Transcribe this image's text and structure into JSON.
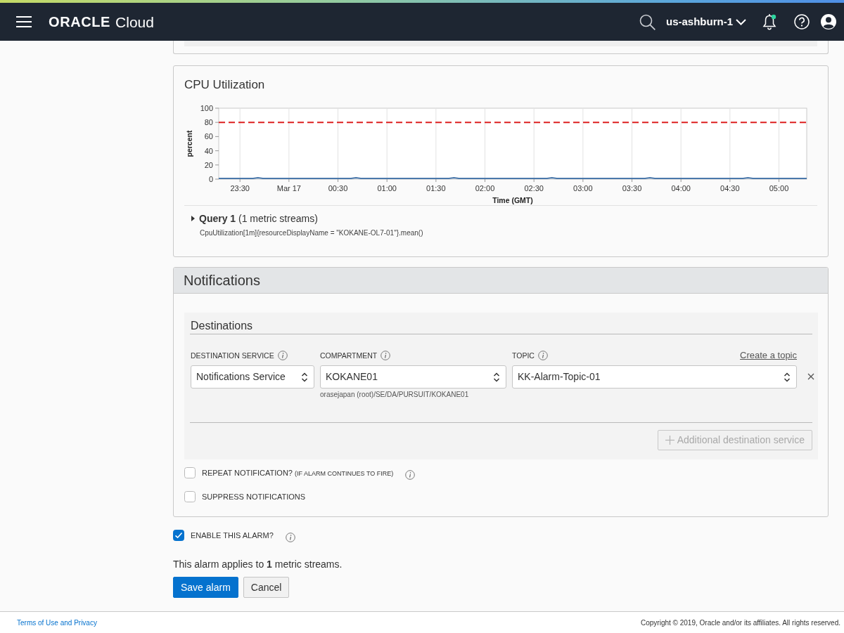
{
  "header": {
    "logo_brand": "ORACLE",
    "logo_product": "Cloud",
    "region": "us-ashburn-1"
  },
  "cpu_panel": {
    "title": "CPU Utilization",
    "chart_data": [
      {
        "type": "line",
        "xlabel": "Time (GMT)",
        "ylabel": "percent",
        "x": [
          "--03-16T23:17",
          "--03-16T23:38",
          "--03-16T23:41",
          "--03-16T23:44",
          "--03-17T00:18",
          "--03-17T00:38",
          "--03-17T00:41",
          "--03-17T00:44",
          "--03-17T01:18",
          "--03-17T01:38",
          "--03-17T01:41",
          "--03-17T01:44",
          "--03-17T02:18",
          "--03-17T02:38",
          "--03-17T02:41",
          "--03-17T02:44",
          "--03-17T03:18",
          "--03-17T03:38",
          "--03-17T03:41",
          "--03-17T03:44",
          "--03-17T04:18",
          "--03-17T04:38",
          "--03-17T04:41",
          "--03-17T04:44",
          "--03-17T05:17"
        ],
        "values": [
          1,
          1,
          2,
          1,
          1,
          1,
          2,
          1,
          1,
          1,
          2,
          1,
          1,
          1,
          2,
          1,
          1,
          1,
          2,
          1,
          1,
          1,
          2,
          1,
          1
        ],
        "color": "#4a78ab",
        "xlim": [
          "--03-16T23:17",
          "--03-17T05:17"
        ],
        "ylim": [
          0,
          100
        ],
        "yticks": [
          0,
          20,
          40,
          60,
          80,
          100
        ],
        "xticks": [
          {
            "value": "--03-16T23:30",
            "label": "23:30"
          },
          {
            "value": "--03-17T00:00",
            "label": "Mar 17"
          },
          {
            "value": "--03-17T00:30",
            "label": "00:30"
          },
          {
            "value": "--03-17T01:00",
            "label": "01:00"
          },
          {
            "value": "--03-17T01:30",
            "label": "01:30"
          },
          {
            "value": "--03-17T02:00",
            "label": "02:00"
          },
          {
            "value": "--03-17T02:30",
            "label": "02:30"
          },
          {
            "value": "--03-17T03:00",
            "label": "03:00"
          },
          {
            "value": "--03-17T03:30",
            "label": "03:30"
          },
          {
            "value": "--03-17T04:00",
            "label": "04:00"
          },
          {
            "value": "--03-17T04:30",
            "label": "04:30"
          },
          {
            "value": "--03-17T05:00",
            "label": "05:00"
          }
        ],
        "grid": "x",
        "ref_lines": [
          {
            "axis": "y",
            "value": 80,
            "color": "#dd1f1f",
            "line_style": "dashed"
          }
        ]
      }
    ],
    "query": {
      "expanded": false,
      "label": "**Query 1** (1 metric streams)",
      "expression": "CpuUtilization[1m]{resourceDisplayName = \"KOKANE-OL7-01\"}.mean()"
    }
  },
  "notifications": {
    "title": "Notifications",
    "destinations": {
      "title": "Destinations",
      "fields": [
        {
          "label": "DESTINATION SERVICE",
          "value": "Notifications Service"
        },
        {
          "label": "COMPARTMENT",
          "value": "KOKANE01",
          "hint": "orasejapan (root)/SE/DA/PURSUIT/KOKANE01"
        },
        {
          "label": "TOPIC",
          "value": "KK-Alarm-Topic-01",
          "link": "Create a topic"
        }
      ],
      "add_button": {
        "label": "Additional destination service",
        "disabled": true
      }
    },
    "options": [
      {
        "label": "REPEAT NOTIFICATION?",
        "note": "(IF ALARM CONTINUES TO FIRE)",
        "checked": false,
        "info": true
      },
      {
        "label": "SUPPRESS NOTIFICATIONS",
        "checked": false,
        "info": false
      }
    ]
  },
  "enable_alarm": {
    "label": "ENABLE THIS ALARM?",
    "checked": true
  },
  "summary": "This alarm applies to **1** metric streams.",
  "buttons": [
    {
      "label": "Save alarm",
      "kind": "primary"
    },
    {
      "label": "Cancel",
      "kind": "secondary"
    }
  ],
  "footer": {
    "link": "Terms of Use and Privacy",
    "copyright": "Copyright © 2019, Oracle and/or its affiliates. All rights reserved."
  }
}
